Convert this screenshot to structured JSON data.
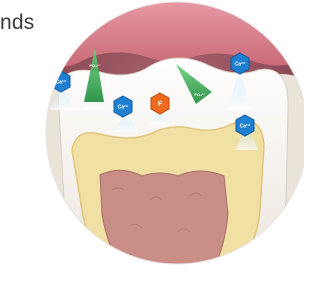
{
  "caption": {
    "text": "nds"
  },
  "ions": {
    "calcium": "Ca²⁺",
    "phosphate": "PO₄³⁻",
    "fluoride": "F"
  },
  "colors": {
    "calcium": "#1f7fd0",
    "phosphate": "#2fa64a",
    "fluoride": "#ee6a1f",
    "gum": "#d97a86",
    "enamel": "#f7f3ee",
    "dentin": "#f1e0a3",
    "pulp": "#c98f86",
    "beam": "#bfe4f7"
  },
  "icons": [
    "calcium-ion",
    "phosphate-ion",
    "fluoride-ion"
  ]
}
